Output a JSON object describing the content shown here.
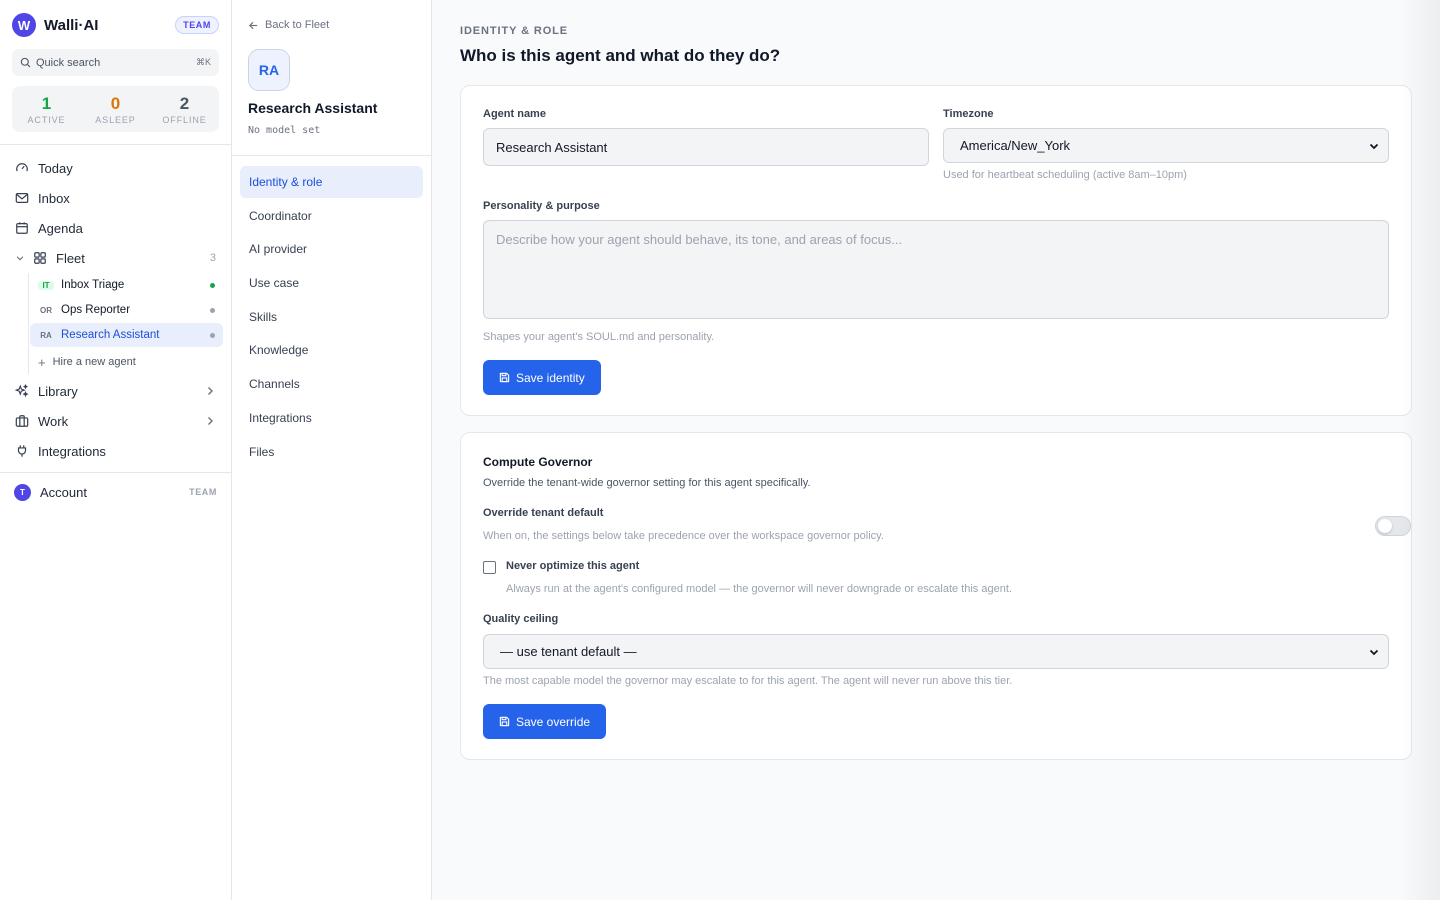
{
  "brand": {
    "logo_letter": "W",
    "name": "Walli·AI",
    "plan_badge": "TEAM"
  },
  "search": {
    "placeholder": "Quick search",
    "shortcut": "⌘K"
  },
  "stats": [
    {
      "value": "1",
      "label": "ACTIVE",
      "color": "#16a34a"
    },
    {
      "value": "0",
      "label": "ASLEEP",
      "color": "#d97706"
    },
    {
      "value": "2",
      "label": "OFFLINE",
      "color": "#4b5563"
    }
  ],
  "nav": {
    "today": "Today",
    "inbox": "Inbox",
    "agenda": "Agenda",
    "fleet": "Fleet",
    "fleet_count": "3",
    "library": "Library",
    "work": "Work",
    "integrations": "Integrations"
  },
  "agents": [
    {
      "initials": "IT",
      "name": "Inbox Triage",
      "status": "active"
    },
    {
      "initials": "OR",
      "name": "Ops Reporter",
      "status": "offline"
    },
    {
      "initials": "RA",
      "name": "Research Assistant",
      "status": "offline",
      "selected": true
    }
  ],
  "hire_label": "Hire a new agent",
  "account": {
    "initial": "T",
    "label": "Account",
    "badge": "TEAM"
  },
  "subnav": {
    "back_label": "Back to Fleet",
    "avatar": "RA",
    "agent_name": "Research Assistant",
    "model": "No model set",
    "items": [
      "Identity & role",
      "Coordinator",
      "AI provider",
      "Use case",
      "Skills",
      "Knowledge",
      "Channels",
      "Integrations",
      "Files"
    ]
  },
  "identity": {
    "eyebrow": "IDENTITY & ROLE",
    "title": "Who is this agent and what do they do?",
    "agent_name_label": "Agent name",
    "agent_name_value": "Research Assistant",
    "timezone_label": "Timezone",
    "timezone_value": "America/New_York",
    "timezone_help": "Used for heartbeat scheduling (active 8am–10pm)",
    "personality_label": "Personality & purpose",
    "personality_placeholder": "Describe how your agent should behave, its tone, and areas of focus...",
    "personality_help": "Shapes your agent's SOUL.md and personality.",
    "save_label": "Save identity"
  },
  "governor": {
    "title": "Compute Governor",
    "description": "Override the tenant-wide governor setting for this agent specifically.",
    "override_label": "Override tenant default",
    "override_help": "When on, the settings below take precedence over the workspace governor policy.",
    "override_on": false,
    "never_optimize_label": "Never optimize this agent",
    "never_optimize_help": "Always run at the agent's configured model — the governor will never downgrade or escalate this agent.",
    "never_optimize_checked": false,
    "quality_label": "Quality ceiling",
    "quality_value": "— use tenant default —",
    "quality_help": "The most capable model the governor may escalate to for this agent. The agent will never run above this tier.",
    "save_label": "Save override"
  },
  "colors": {
    "accent": "#2563eb",
    "brand": "#4f46e5",
    "active": "#16a34a",
    "asleep": "#d97706"
  }
}
